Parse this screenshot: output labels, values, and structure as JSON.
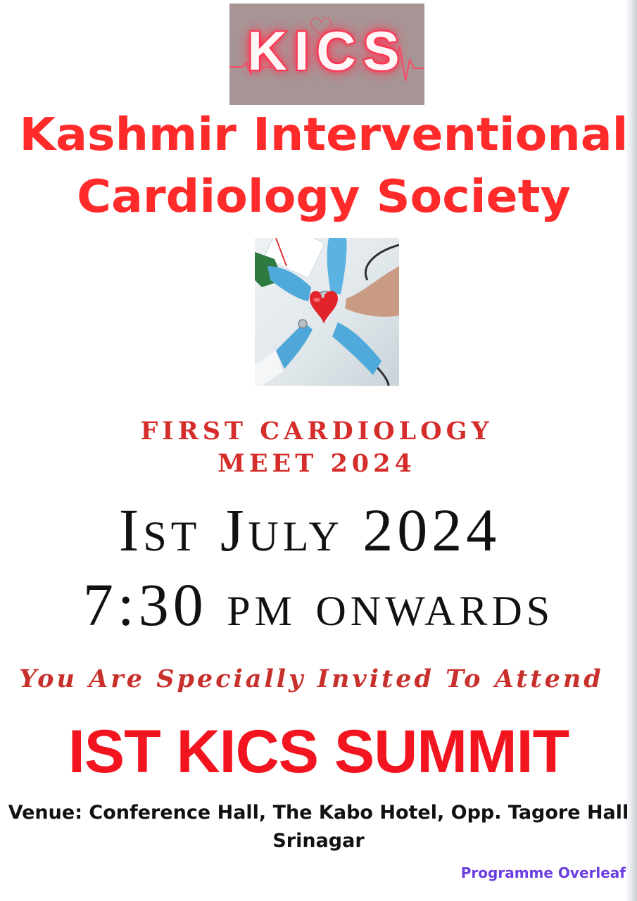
{
  "logo": {
    "text": "KICS"
  },
  "society": {
    "line1": "Kashmir Interventional",
    "line2": "Cardiology Society"
  },
  "photo": {
    "description_icon": "hands-holding-heart-icon"
  },
  "meet": {
    "line1": "FIRST CARDIOLOGY",
    "line2": "MEET 2024"
  },
  "event": {
    "date": "Ist July 2024",
    "time": "7:30 pm onwards"
  },
  "invite": "You Are Specially Invited To Attend",
  "summit": "IST KICS SUMMIT",
  "venue": {
    "line1": "Venue: Conference Hall, The Kabo Hotel,  Opp. Tagore Hall",
    "line2": "Srinagar"
  },
  "footer": {
    "overleaf": "Programme Overleaf"
  },
  "colors": {
    "title_red": "#ff2a2a",
    "meet_red": "#d42d2a",
    "summit_red": "#f2141e",
    "overleaf_purple": "#6a3ee0"
  }
}
